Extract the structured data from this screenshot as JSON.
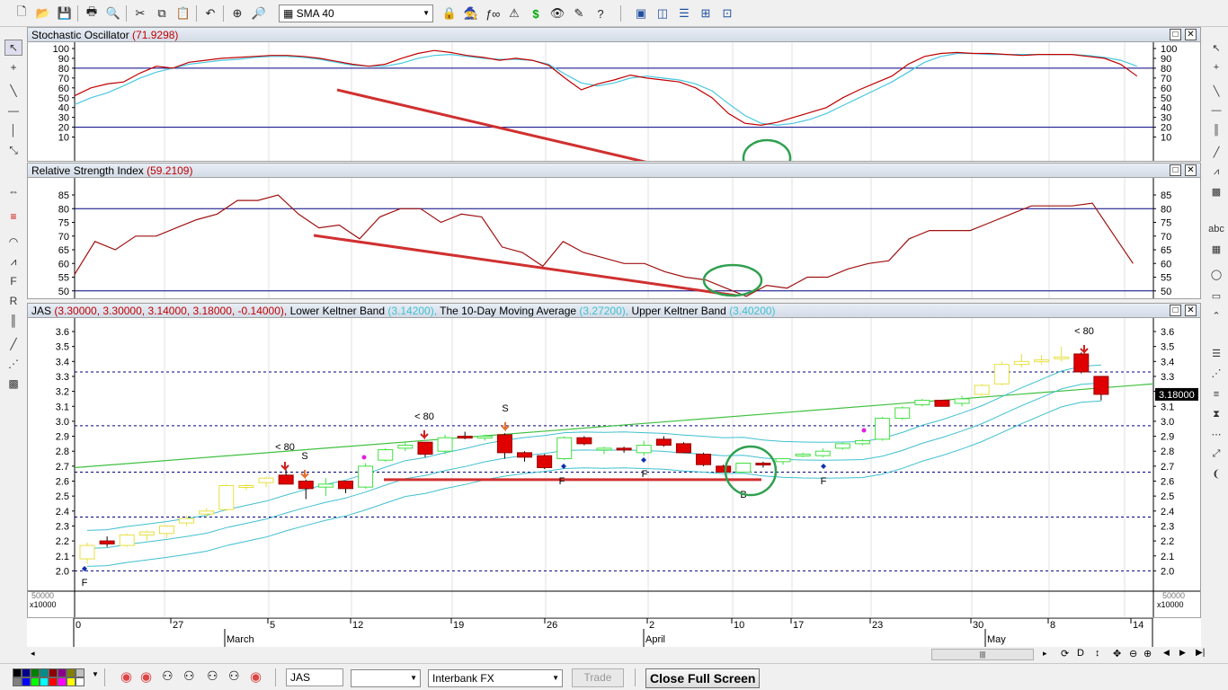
{
  "toolbar": {
    "indicator_select": "SMA 40"
  },
  "panes": {
    "stoch": {
      "name": "Stochastic Oscillator",
      "value": "(71.9298)",
      "yticks": [
        "100",
        "90",
        "80",
        "70",
        "60",
        "50",
        "40",
        "30",
        "20",
        "10"
      ]
    },
    "rsi": {
      "name": "Relative Strength Index",
      "value": "(59.2109)",
      "yticks": [
        "85",
        "80",
        "75",
        "70",
        "65",
        "60",
        "55",
        "50"
      ]
    },
    "price": {
      "symbol": "JAS",
      "ohlc": "(3.30000, 3.30000, 3.14000, 3.18000, -0.14000),",
      "lower_name": "Lower Keltner Band",
      "lower_val": "(3.14200),",
      "ma_name": "The 10-Day Moving Average",
      "ma_val": "(3.27200),",
      "upper_name": "Upper Keltner Band",
      "upper_val": "(3.40200)",
      "yticks": [
        "3.6",
        "3.5",
        "3.4",
        "3.3",
        "3.2",
        "3.1",
        "3.0",
        "2.9",
        "2.8",
        "2.7",
        "2.6",
        "2.5",
        "2.4",
        "2.3",
        "2.2",
        "2.1",
        "2.0"
      ],
      "last_price": "3.18000",
      "annotations": {
        "lt80_a": "< 80",
        "lt80_b": "< 80",
        "lt80_c": "< 80",
        "s_a": "S",
        "s_b": "S",
        "f_a": "F",
        "f_b": "F",
        "f_c": "F",
        "f_d": "F",
        "b_a": "B"
      }
    },
    "volume": {
      "multiplier": "x10000",
      "scale": "50000"
    }
  },
  "dates": {
    "days": [
      "0",
      "27",
      "5",
      "12",
      "19",
      "26",
      "2",
      "10",
      "17",
      "23",
      "30",
      "8",
      "14"
    ],
    "months": [
      "March",
      "April",
      "May"
    ]
  },
  "bottombar": {
    "symbol": "JAS",
    "feed": "Interbank FX",
    "trade": "Trade",
    "close_fullscreen": "Close Full Screen"
  },
  "colors": {
    "stoch_k": "#c00000",
    "stoch_d": "#48c8e0",
    "rsi": "#a01010",
    "keltner": "#40c0d0",
    "trend": "#40c040",
    "bull": "#40e040",
    "bear": "#e00000",
    "annotation": "#d04040",
    "circle": "#30a050"
  },
  "chart_data": [
    {
      "type": "line",
      "title": "Stochastic Oscillator",
      "ylim": [
        10,
        100
      ],
      "hlines": [
        80,
        20
      ],
      "series": [
        {
          "name": "%K",
          "values": [
            [
              0,
              52
            ],
            [
              1,
              60
            ],
            [
              2,
              64
            ],
            [
              3,
              66
            ],
            [
              4,
              75
            ],
            [
              5,
              82
            ],
            [
              6,
              80
            ],
            [
              7,
              86
            ],
            [
              8,
              88
            ],
            [
              9,
              90
            ],
            [
              10,
              91
            ],
            [
              11,
              92
            ],
            [
              12,
              93
            ],
            [
              13,
              93
            ],
            [
              14,
              92
            ],
            [
              15,
              90
            ],
            [
              16,
              87
            ],
            [
              17,
              84
            ],
            [
              18,
              82
            ],
            [
              19,
              84
            ],
            [
              20,
              90
            ],
            [
              21,
              95
            ],
            [
              22,
              98
            ],
            [
              23,
              96
            ],
            [
              24,
              93
            ],
            [
              25,
              91
            ],
            [
              26,
              88
            ],
            [
              27,
              90
            ],
            [
              28,
              88
            ],
            [
              29,
              83
            ],
            [
              30,
              70
            ],
            [
              31,
              58
            ],
            [
              32,
              64
            ],
            [
              33,
              68
            ],
            [
              34,
              73
            ],
            [
              35,
              70
            ],
            [
              36,
              68
            ],
            [
              37,
              66
            ],
            [
              38,
              60
            ],
            [
              39,
              50
            ],
            [
              40,
              34
            ],
            [
              41,
              24
            ],
            [
              42,
              22
            ],
            [
              43,
              25
            ],
            [
              44,
              30
            ],
            [
              45,
              35
            ],
            [
              46,
              40
            ],
            [
              47,
              50
            ],
            [
              48,
              58
            ],
            [
              49,
              65
            ],
            [
              50,
              72
            ],
            [
              51,
              84
            ],
            [
              52,
              92
            ],
            [
              53,
              95
            ],
            [
              54,
              96
            ],
            [
              55,
              95
            ],
            [
              56,
              95
            ],
            [
              57,
              94
            ],
            [
              58,
              93
            ],
            [
              59,
              94
            ],
            [
              60,
              94
            ],
            [
              61,
              94
            ],
            [
              62,
              92
            ],
            [
              63,
              90
            ],
            [
              64,
              84
            ],
            [
              65,
              72
            ]
          ]
        },
        {
          "name": "%D",
          "values": [
            [
              0,
              43
            ],
            [
              1,
              50
            ],
            [
              2,
              55
            ],
            [
              3,
              62
            ],
            [
              4,
              70
            ],
            [
              5,
              76
            ],
            [
              6,
              80
            ],
            [
              7,
              84
            ],
            [
              8,
              86
            ],
            [
              9,
              88
            ],
            [
              10,
              89
            ],
            [
              11,
              91
            ],
            [
              12,
              92
            ],
            [
              13,
              92
            ],
            [
              14,
              91
            ],
            [
              15,
              89
            ],
            [
              16,
              86
            ],
            [
              17,
              83
            ],
            [
              18,
              82
            ],
            [
              19,
              82
            ],
            [
              20,
              85
            ],
            [
              21,
              90
            ],
            [
              22,
              93
            ],
            [
              23,
              94
            ],
            [
              24,
              92
            ],
            [
              25,
              90
            ],
            [
              26,
              89
            ],
            [
              27,
              89
            ],
            [
              28,
              88
            ],
            [
              29,
              84
            ],
            [
              30,
              74
            ],
            [
              31,
              65
            ],
            [
              32,
              62
            ],
            [
              33,
              65
            ],
            [
              34,
              70
            ],
            [
              35,
              72
            ],
            [
              36,
              70
            ],
            [
              37,
              68
            ],
            [
              38,
              64
            ],
            [
              39,
              57
            ],
            [
              40,
              44
            ],
            [
              41,
              32
            ],
            [
              42,
              24
            ],
            [
              43,
              22
            ],
            [
              44,
              24
            ],
            [
              45,
              28
            ],
            [
              46,
              34
            ],
            [
              47,
              42
            ],
            [
              48,
              50
            ],
            [
              49,
              58
            ],
            [
              50,
              66
            ],
            [
              51,
              76
            ],
            [
              52,
              86
            ],
            [
              53,
              92
            ],
            [
              54,
              95
            ],
            [
              55,
              95
            ],
            [
              56,
              94
            ],
            [
              57,
              94
            ],
            [
              58,
              94
            ],
            [
              59,
              94
            ],
            [
              60,
              94
            ],
            [
              61,
              94
            ],
            [
              62,
              93
            ],
            [
              63,
              91
            ],
            [
              64,
              88
            ],
            [
              65,
              82
            ]
          ]
        }
      ]
    },
    {
      "type": "line",
      "title": "Relative Strength Index",
      "ylim": [
        47,
        88
      ],
      "hlines": [
        80,
        50
      ],
      "series": [
        {
          "name": "RSI",
          "values": [
            [
              0,
              56
            ],
            [
              1,
              68
            ],
            [
              2,
              65
            ],
            [
              3,
              70
            ],
            [
              4,
              70
            ],
            [
              5,
              73
            ],
            [
              6,
              76
            ],
            [
              7,
              78
            ],
            [
              8,
              83
            ],
            [
              9,
              83
            ],
            [
              10,
              85
            ],
            [
              11,
              78
            ],
            [
              12,
              73
            ],
            [
              13,
              74
            ],
            [
              14,
              69
            ],
            [
              15,
              77
            ],
            [
              16,
              80
            ],
            [
              17,
              80
            ],
            [
              18,
              75
            ],
            [
              19,
              78
            ],
            [
              20,
              77
            ],
            [
              21,
              66
            ],
            [
              22,
              64
            ],
            [
              23,
              59
            ],
            [
              24,
              68
            ],
            [
              25,
              64
            ],
            [
              26,
              62
            ],
            [
              27,
              60
            ],
            [
              28,
              60
            ],
            [
              29,
              57
            ],
            [
              30,
              55
            ],
            [
              31,
              54
            ],
            [
              32,
              51
            ],
            [
              33,
              48
            ],
            [
              34,
              52
            ],
            [
              35,
              51
            ],
            [
              36,
              55
            ],
            [
              37,
              55
            ],
            [
              38,
              58
            ],
            [
              39,
              60
            ],
            [
              40,
              61
            ],
            [
              41,
              69
            ],
            [
              42,
              72
            ],
            [
              43,
              72
            ],
            [
              44,
              72
            ],
            [
              45,
              75
            ],
            [
              46,
              78
            ],
            [
              47,
              81
            ],
            [
              48,
              81
            ],
            [
              49,
              81
            ],
            [
              50,
              82
            ],
            [
              51,
              71
            ],
            [
              52,
              60
            ]
          ]
        }
      ]
    },
    {
      "type": "candlestick",
      "title": "JAS",
      "ylim": [
        1.95,
        3.65
      ],
      "candles": [
        [
          2.08,
          2.19,
          2.05,
          2.17
        ],
        [
          2.2,
          2.23,
          2.16,
          2.18
        ],
        [
          2.17,
          2.25,
          2.16,
          2.24
        ],
        [
          2.24,
          2.27,
          2.2,
          2.26
        ],
        [
          2.25,
          2.28,
          2.22,
          2.3
        ],
        [
          2.32,
          2.37,
          2.3,
          2.35
        ],
        [
          2.38,
          2.42,
          2.36,
          2.4
        ],
        [
          2.41,
          2.58,
          2.4,
          2.57
        ],
        [
          2.56,
          2.58,
          2.54,
          2.57
        ],
        [
          2.59,
          2.63,
          2.56,
          2.62
        ],
        [
          2.64,
          2.68,
          2.58,
          2.58
        ],
        [
          2.6,
          2.61,
          2.48,
          2.55
        ],
        [
          2.56,
          2.62,
          2.5,
          2.58
        ],
        [
          2.6,
          2.6,
          2.52,
          2.55
        ],
        [
          2.56,
          2.72,
          2.55,
          2.7
        ],
        [
          2.74,
          2.82,
          2.73,
          2.81
        ],
        [
          2.82,
          2.86,
          2.8,
          2.84
        ],
        [
          2.86,
          2.86,
          2.76,
          2.78
        ],
        [
          2.8,
          2.91,
          2.78,
          2.89
        ],
        [
          2.9,
          2.93,
          2.88,
          2.89
        ],
        [
          2.9,
          2.91,
          2.87,
          2.9
        ],
        [
          2.91,
          2.92,
          2.75,
          2.79
        ],
        [
          2.79,
          2.8,
          2.73,
          2.76
        ],
        [
          2.77,
          2.78,
          2.68,
          2.69
        ],
        [
          2.75,
          2.9,
          2.74,
          2.89
        ],
        [
          2.89,
          2.9,
          2.84,
          2.85
        ],
        [
          2.81,
          2.83,
          2.78,
          2.82
        ],
        [
          2.82,
          2.83,
          2.79,
          2.81
        ],
        [
          2.79,
          2.87,
          2.77,
          2.84
        ],
        [
          2.88,
          2.9,
          2.83,
          2.84
        ],
        [
          2.85,
          2.86,
          2.79,
          2.79
        ],
        [
          2.78,
          2.79,
          2.7,
          2.71
        ],
        [
          2.7,
          2.71,
          2.66,
          2.66
        ],
        [
          2.66,
          2.72,
          2.66,
          2.72
        ],
        [
          2.72,
          2.73,
          2.69,
          2.71
        ],
        [
          2.73,
          2.75,
          2.71,
          2.75
        ],
        [
          2.77,
          2.79,
          2.76,
          2.78
        ],
        [
          2.77,
          2.82,
          2.76,
          2.8
        ],
        [
          2.82,
          2.86,
          2.81,
          2.85
        ],
        [
          2.85,
          2.88,
          2.84,
          2.87
        ],
        [
          2.88,
          3.03,
          2.87,
          3.02
        ],
        [
          3.02,
          3.1,
          3.01,
          3.09
        ],
        [
          3.11,
          3.15,
          3.1,
          3.14
        ],
        [
          3.14,
          3.14,
          3.1,
          3.1
        ],
        [
          3.12,
          3.17,
          3.1,
          3.15
        ],
        [
          3.18,
          3.25,
          3.17,
          3.24
        ],
        [
          3.25,
          3.4,
          3.24,
          3.38
        ],
        [
          3.38,
          3.45,
          3.36,
          3.4
        ],
        [
          3.4,
          3.44,
          3.38,
          3.41
        ],
        [
          3.42,
          3.5,
          3.4,
          3.43
        ],
        [
          3.45,
          3.46,
          3.32,
          3.33
        ],
        [
          3.3,
          3.3,
          3.14,
          3.18
        ]
      ],
      "sma40": {
        "start": 2.69,
        "end": 3.25
      },
      "hlines": [
        3.33,
        2.97,
        2.66,
        2.36,
        2.0
      ],
      "support_line": 2.61
    }
  ]
}
